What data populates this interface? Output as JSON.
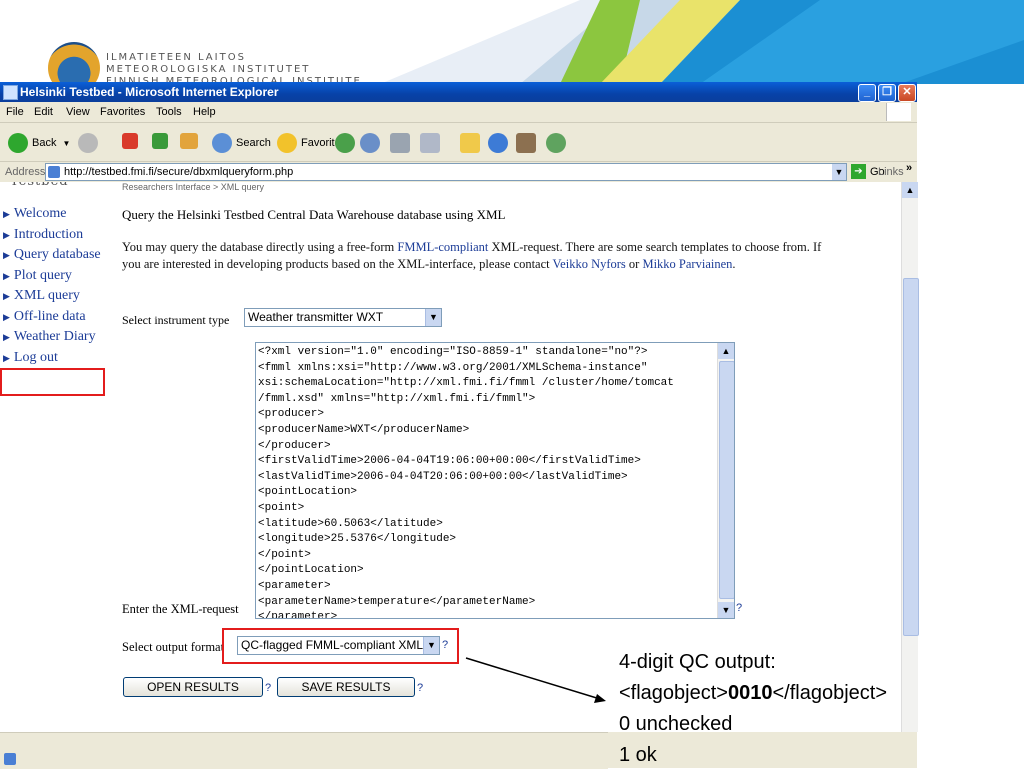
{
  "slide": {
    "org_line1": "ILMATIETEEN LAITOS",
    "org_line2": "METEOROLOGISKA INSTITUTET",
    "org_line3": "FINNISH METEOROLOGICAL INSTITUTE"
  },
  "window": {
    "title": "Helsinki Testbed - Microsoft Internet Explorer",
    "menu": [
      "File",
      "Edit",
      "View",
      "Favorites",
      "Tools",
      "Help"
    ],
    "toolbar": {
      "back": "Back",
      "search": "Search",
      "favorites": "Favorites"
    },
    "address_label": "Address",
    "address_url": "http://testbed.fmi.fi/secure/dbxmlqueryform.php",
    "go": "Go",
    "links": "Links"
  },
  "page": {
    "logo_text": "Testbed",
    "breadcrumb": "Researchers Interface > XML query",
    "nav": [
      "Welcome",
      "Introduction",
      "Query database",
      "Plot query",
      "XML query",
      "Off-line data",
      "Weather Diary",
      "Log out"
    ],
    "title": "Query the Helsinki Testbed Central Data Warehouse database using XML",
    "intro_1": "You may query the database directly using a free-form ",
    "intro_link1": "FMML-compliant",
    "intro_2": " XML-request. There are some search templates to choose from. If you are interested in developing products based on the XML-interface, please contact ",
    "intro_link2": "Veikko Nyfors",
    "intro_3": " or ",
    "intro_link3": "Mikko Parviainen",
    "intro_4": ".",
    "instrument_label": "Select instrument type",
    "instrument_value": "Weather transmitter WXT",
    "xml_label": "Enter the XML-request",
    "xml_request": "<?xml version=\"1.0\" encoding=\"ISO-8859-1\" standalone=\"no\"?>\n<fmml xmlns:xsi=\"http://www.w3.org/2001/XMLSchema-instance\"\nxsi:schemaLocation=\"http://xml.fmi.fi/fmml /cluster/home/tomcat\n/fmml.xsd\" xmlns=\"http://xml.fmi.fi/fmml\">\n<producer>\n<producerName>WXT</producerName>\n</producer>\n<firstValidTime>2006-04-04T19:06:00+00:00</firstValidTime>\n<lastValidTime>2006-04-04T20:06:00+00:00</lastValidTime>\n<pointLocation>\n<point>\n<latitude>60.5063</latitude>\n<longitude>25.5376</longitude>\n</point>\n</pointLocation>\n<parameter>\n<parameterName>temperature</parameterName>\n</parameter>\n<flag></flag>",
    "help": "?",
    "output_label": "Select output format",
    "output_value": "QC-flagged FMML-compliant XML",
    "open_button": "OPEN RESULTS",
    "save_button": "SAVE RESULTS"
  },
  "annotation": {
    "line1": "4-digit QC output:",
    "line2_pre": "<flagobject>",
    "line2_bold": "0010",
    "line2_post": "</flagobject>",
    "line3": "0 unchecked",
    "line4": "1 ok"
  },
  "colors": {
    "highlight": "#e31c1c",
    "link": "#1c3c97",
    "titlebar": "#0842a8"
  }
}
